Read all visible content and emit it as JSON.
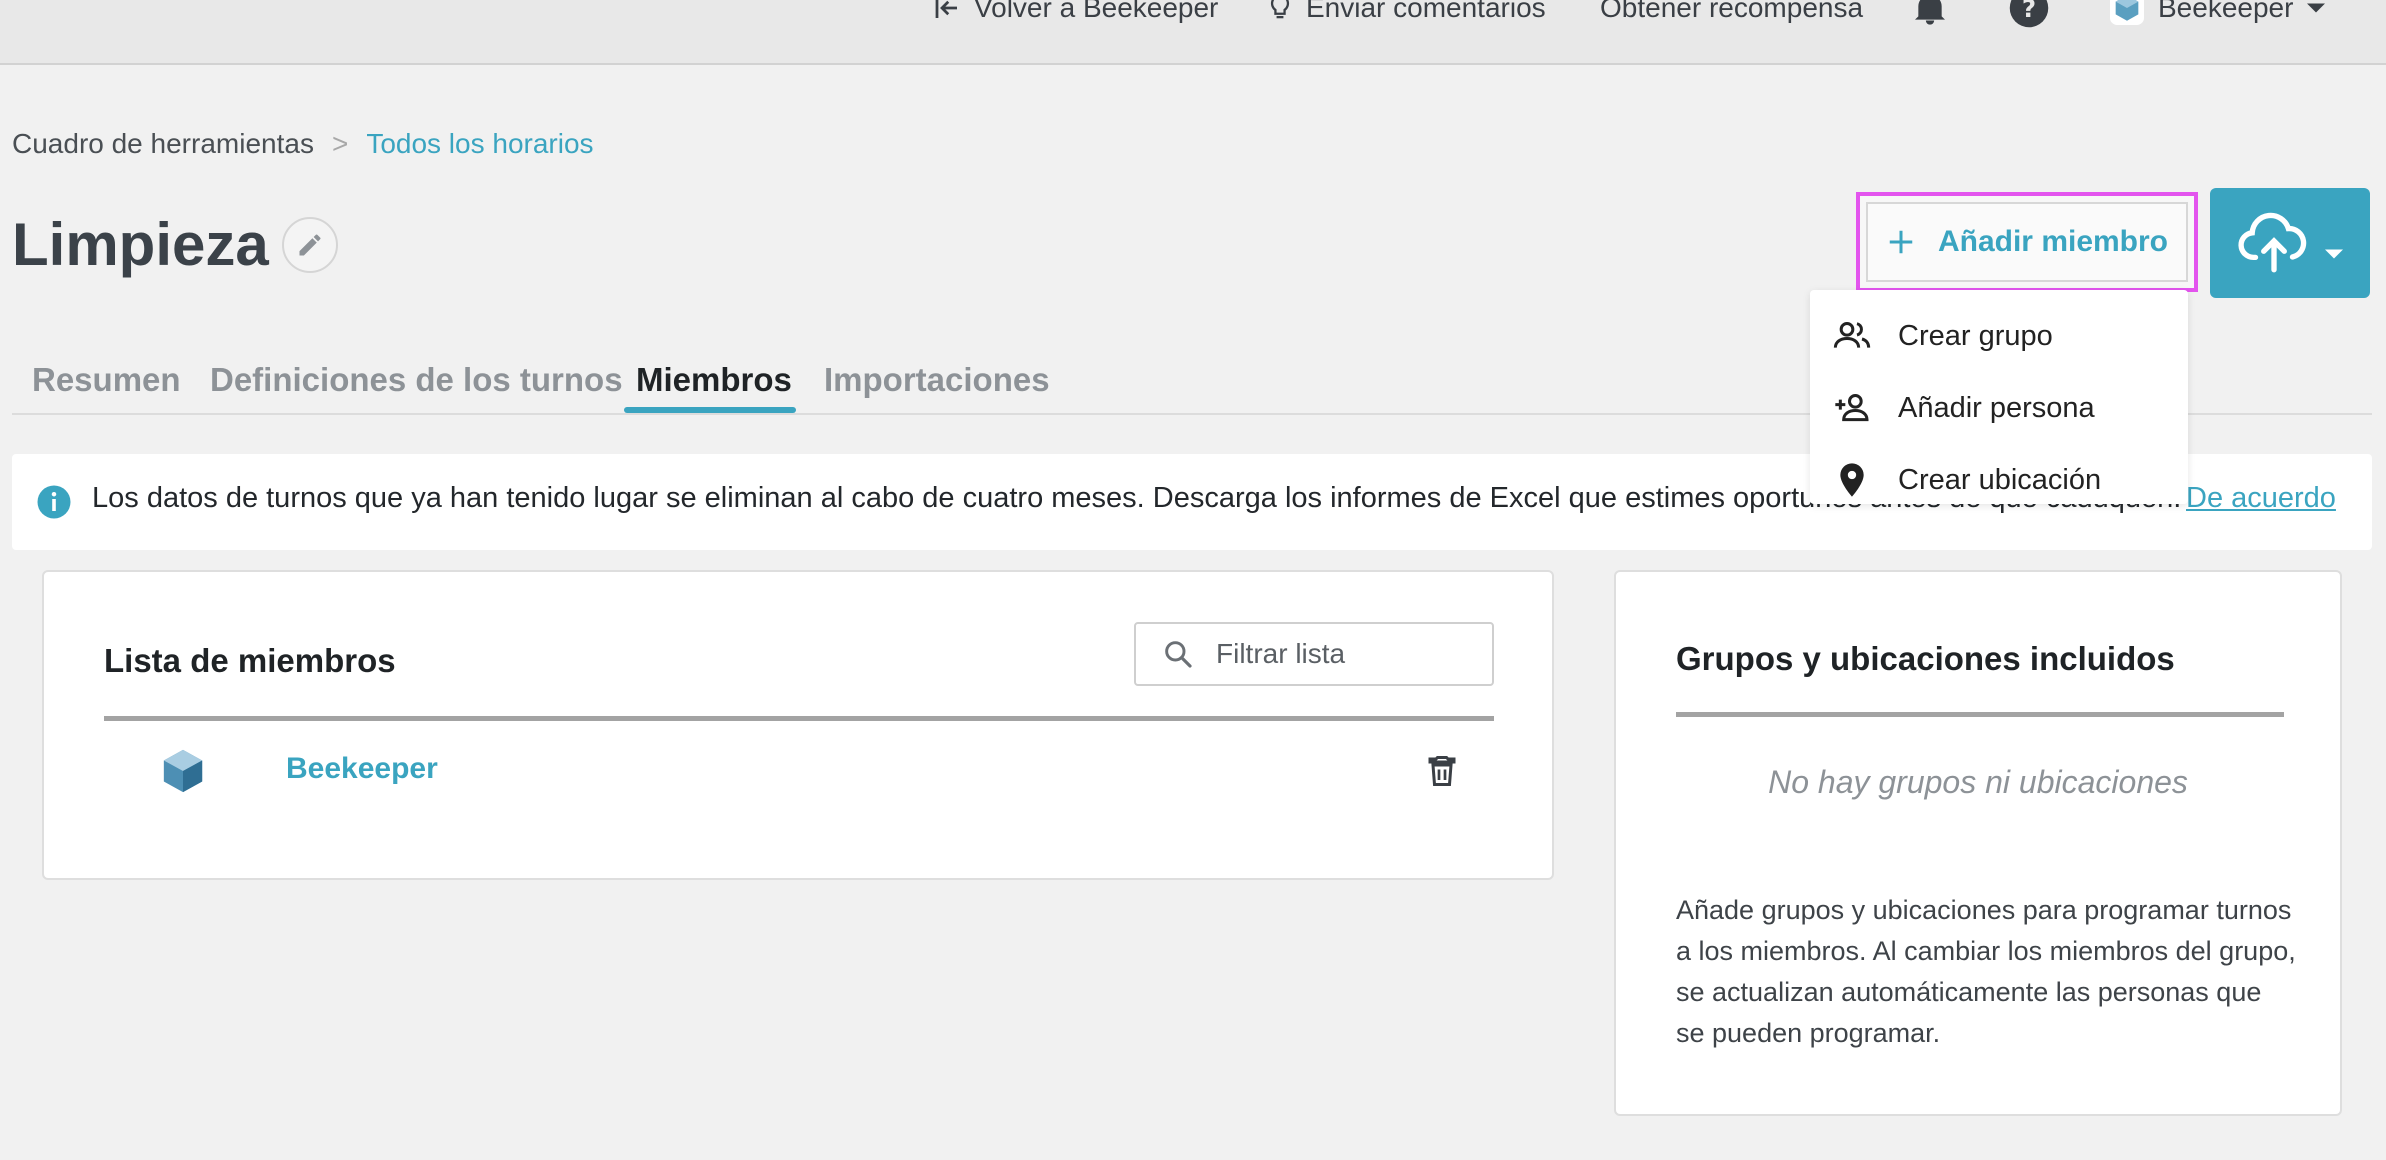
{
  "topbar": {
    "back_label": "Volver a Beekeeper",
    "feedback_label": "Enviar comentarios",
    "reward_label": "Obtener recompensa",
    "account_label": "Beekeeper"
  },
  "breadcrumb": {
    "parent": "Cuadro de herramientas",
    "separator": ">",
    "current": "Todos los horarios"
  },
  "page": {
    "title": "Limpieza"
  },
  "actions": {
    "add_member_label": "Añadir miembro"
  },
  "dropdown": {
    "items": [
      {
        "label": "Crear grupo",
        "icon": "group-icon"
      },
      {
        "label": "Añadir persona",
        "icon": "add-person-icon"
      },
      {
        "label": "Crear ubicación",
        "icon": "location-pin-icon"
      }
    ]
  },
  "tabs": [
    {
      "label": "Resumen",
      "active": false
    },
    {
      "label": "Definiciones de los turnos",
      "active": false
    },
    {
      "label": "Miembros",
      "active": true
    },
    {
      "label": "Importaciones",
      "active": false
    }
  ],
  "banner": {
    "text": "Los datos de turnos que ya han tenido lugar se eliminan al cabo de cuatro meses. Descarga los informes de Excel que estimes oportunos antes de que caduquen.",
    "link": "De acuerdo"
  },
  "members": {
    "title": "Lista de miembros",
    "filter_placeholder": "Filtrar lista",
    "rows": [
      {
        "name": "Beekeeper"
      }
    ]
  },
  "groups": {
    "title": "Grupos y ubicaciones incluidos",
    "empty": "No hay grupos ni ubicaciones",
    "help": "Añade grupos y ubicaciones para programar turnos a los miembros. Al cambiar los miembros del grupo, se actualizan automáticamente las personas que se pueden programar."
  },
  "colors": {
    "accent": "#3aa4c0",
    "highlight": "#e354ee"
  }
}
